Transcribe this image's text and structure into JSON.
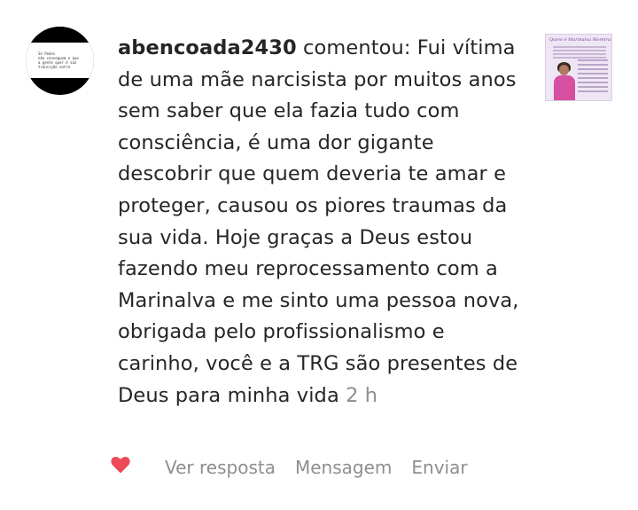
{
  "comment": {
    "username": "abencoada2430",
    "verb": "comentou:",
    "text": "Fui vítima de uma mãe narcisista por muitos anos sem saber que ela fazia tudo com consciência, é uma dor gigante descobrir que quem deveria te amar e proteger, causou os piores traumas da sua vida. Hoje graças a Deus estou fazendo meu reprocessamento com a Marinalva e me sinto uma pessoa nova, obrigada pelo profissionalismo e carinho, você e a TRG são presentes de Deus para minha vida",
    "time": "2 h"
  },
  "avatar": {
    "lines": [
      "Só Pedes",
      "não conseguem o que",
      "a gente quer é saz",
      "transição entre"
    ]
  },
  "post_thumbnail": {
    "title": "Quem é Marinalva Moreira?"
  },
  "actions": {
    "like_icon": "heart-icon",
    "like_color": "#ed4956",
    "reply_label": "Ver resposta",
    "message_label": "Mensagem",
    "send_label": "Enviar"
  }
}
